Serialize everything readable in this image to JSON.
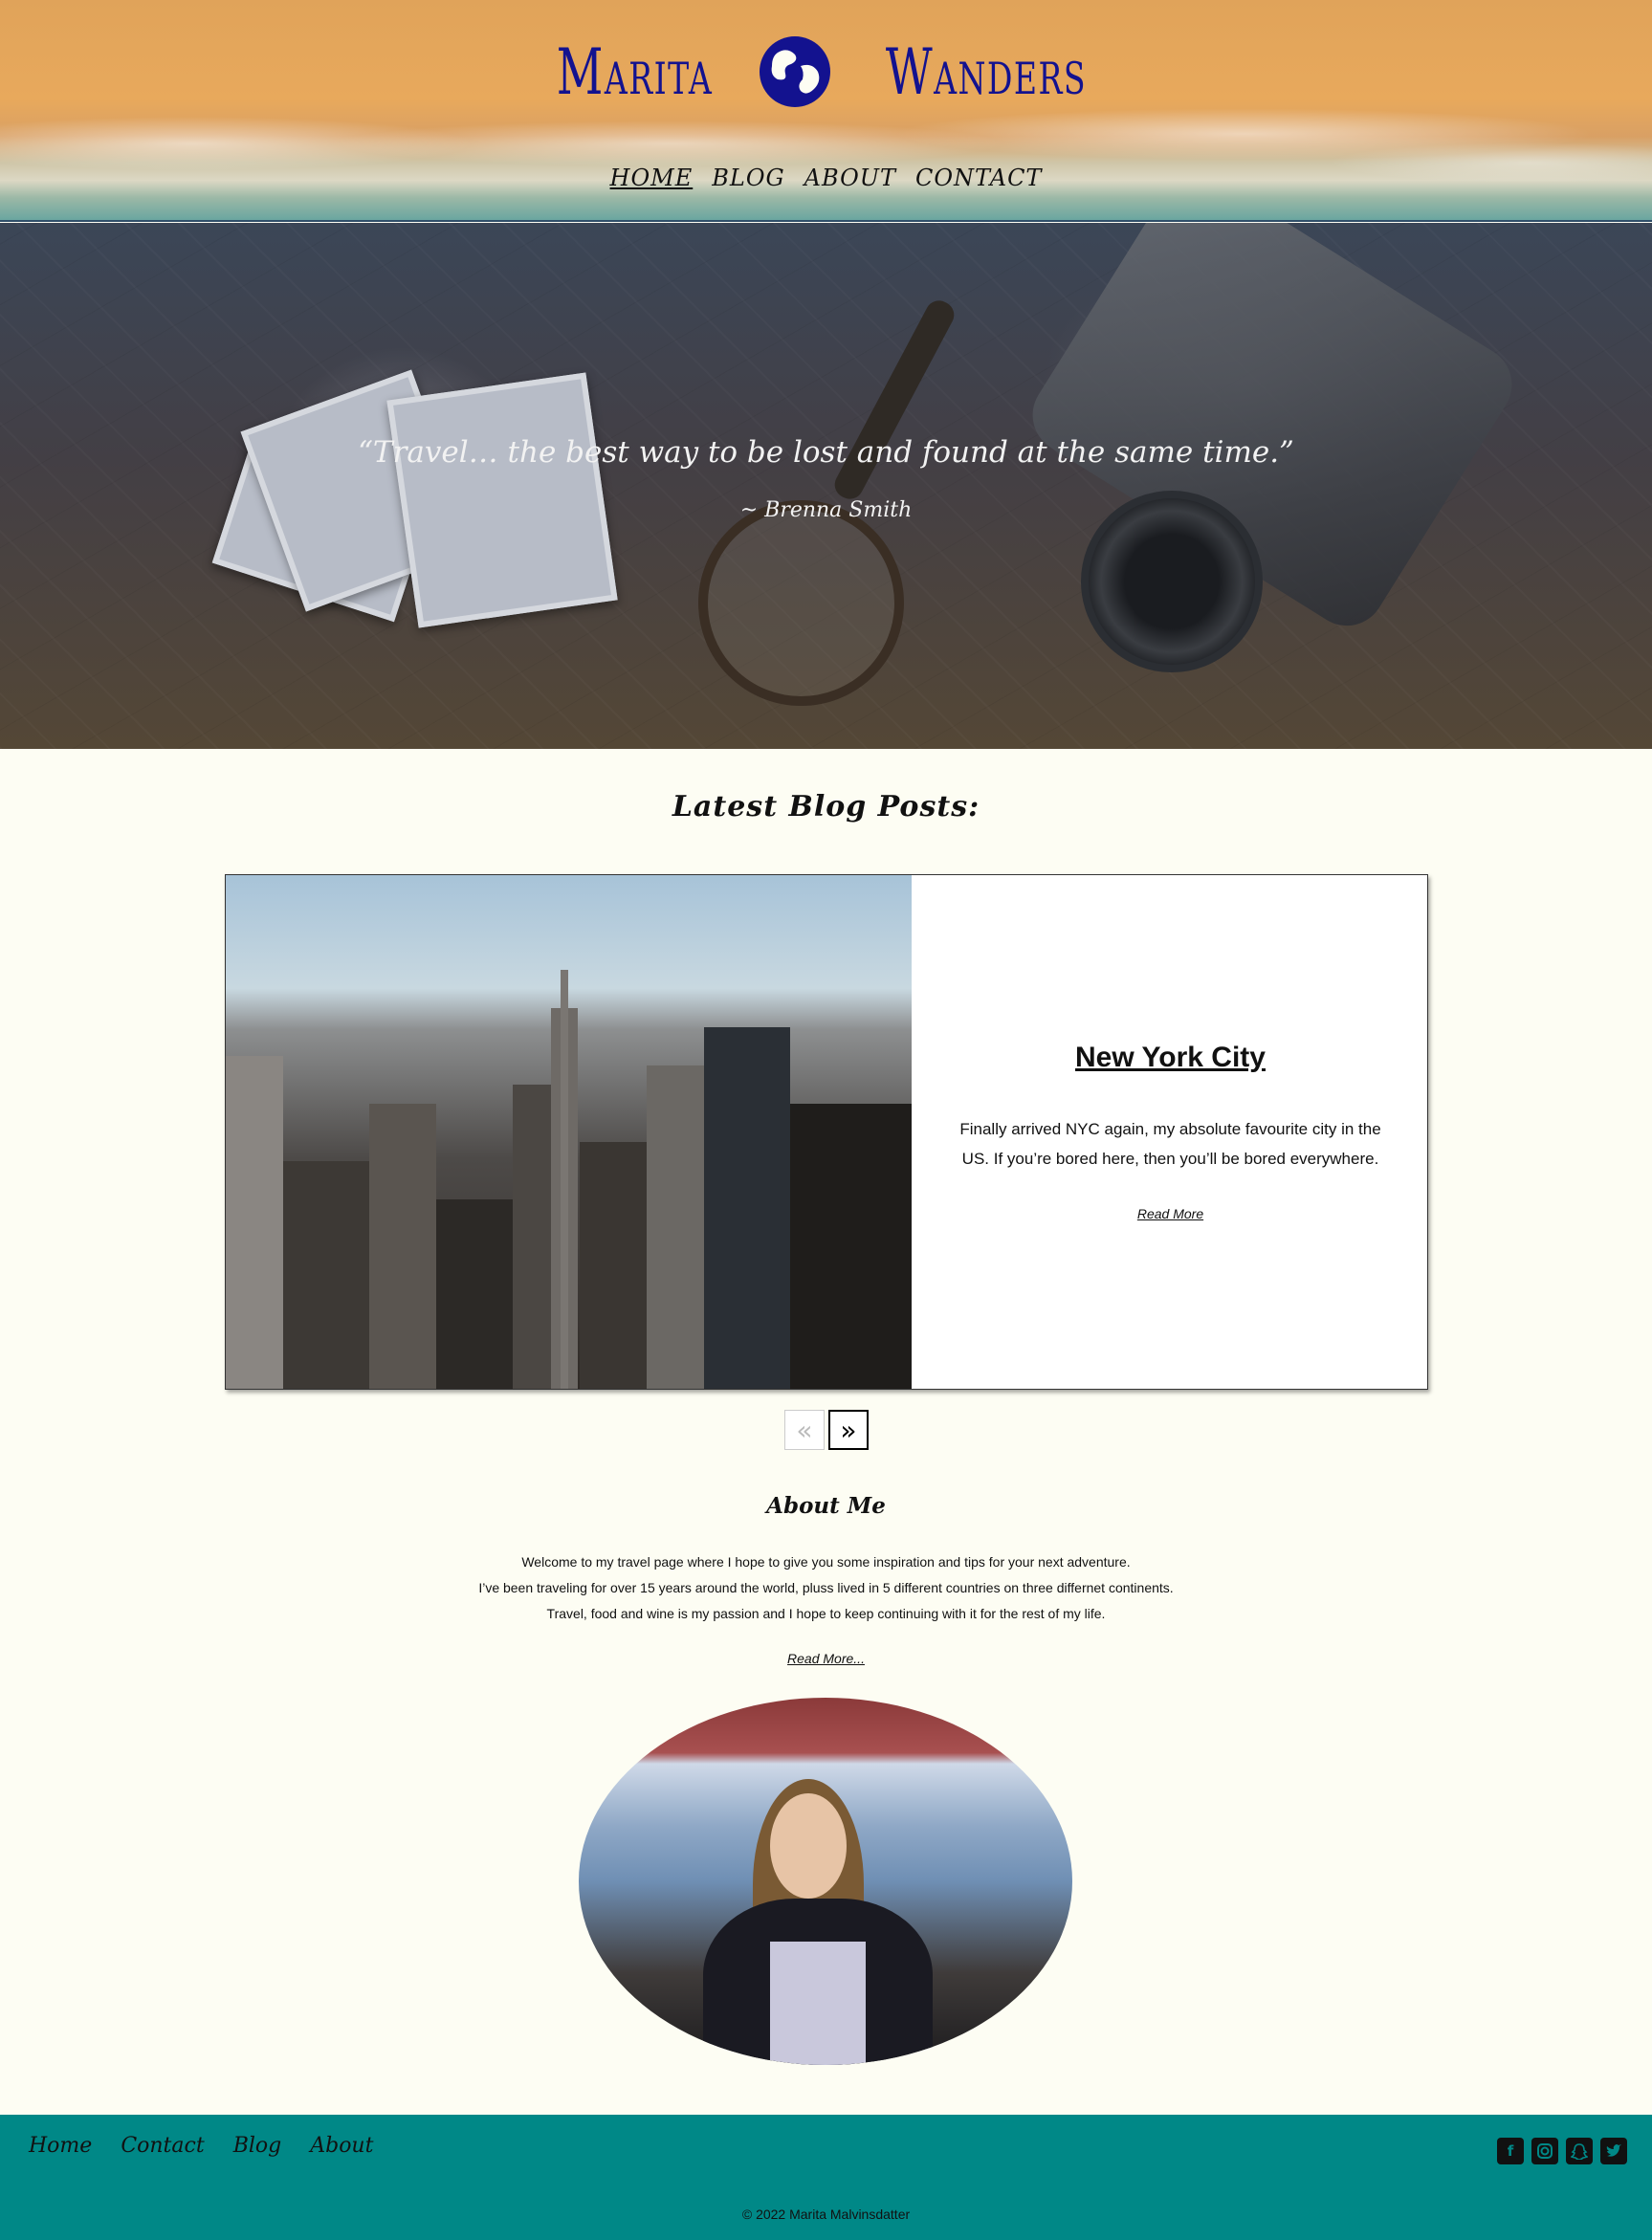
{
  "header": {
    "logo_left": "Marita",
    "logo_right": "Wanders",
    "nav": [
      "HOME",
      "BLOG",
      "ABOUT",
      "CONTACT"
    ],
    "active_nav": "HOME"
  },
  "hero": {
    "quote": "“Travel… the best way to be lost and found at the same time.”",
    "author": "~ Brenna Smith"
  },
  "blog": {
    "section_title": "Latest Blog Posts:",
    "post": {
      "title": "New York City",
      "excerpt": "Finally arrived NYC again, my absolute favourite city in the US. If you’re bored here, then you’ll be bored everywhere.",
      "read_more": "Read More"
    },
    "pager": {
      "prev_icon": "«",
      "next_icon": "»"
    }
  },
  "about": {
    "title": "About Me",
    "lines": [
      "Welcome to my travel page where I hope to give you some inspiration and tips for your next adventure.",
      "I’ve been traveling for over 15 years around the world, pluss lived in 5 different countries on three differnet continents.",
      "Travel, food and wine is my passion and I hope to keep continuing with it for the rest of my life."
    ],
    "read_more": "Read More..."
  },
  "footer": {
    "nav": [
      "Home",
      "Contact",
      "Blog",
      "About"
    ],
    "social": [
      "facebook-icon",
      "instagram-icon",
      "snapchat-icon",
      "twitter-icon"
    ],
    "copyright": "© 2022 Marita Malvinsdatter"
  },
  "colors": {
    "logo": "#13128f",
    "footer_bg": "#008887",
    "page_bg": "#fdfdf3"
  }
}
